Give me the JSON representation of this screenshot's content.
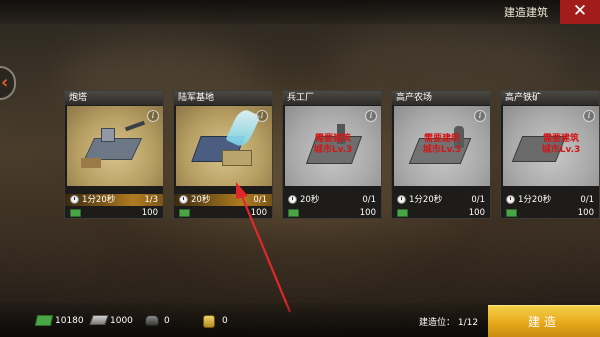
{
  "header": {
    "title": "建造建筑"
  },
  "cards": [
    {
      "name": "炮塔",
      "time": "1分20秒",
      "count": "1/3",
      "cost": "100",
      "available": true,
      "highlight_time": true,
      "requirement": ""
    },
    {
      "name": "陆军基地",
      "time": "20秒",
      "count": "0/1",
      "cost": "100",
      "available": true,
      "highlight_time": true,
      "requirement": ""
    },
    {
      "name": "兵工厂",
      "time": "20秒",
      "count": "0/1",
      "cost": "100",
      "available": false,
      "highlight_time": false,
      "requirement": "需要建筑\n城市Lv.3"
    },
    {
      "name": "高产农场",
      "time": "1分20秒",
      "count": "0/1",
      "cost": "100",
      "available": false,
      "highlight_time": false,
      "requirement": "需要建筑\n城市Lv.3"
    },
    {
      "name": "高产铁矿",
      "time": "1分20秒",
      "count": "0/1",
      "cost": "100",
      "available": false,
      "highlight_time": false,
      "requirement": "需要建筑\n城市Lv.3"
    }
  ],
  "resources": [
    {
      "icon": "cash-icon",
      "value": "10180"
    },
    {
      "icon": "steel-icon",
      "value": "1000"
    },
    {
      "icon": "oil-icon",
      "value": "0"
    },
    {
      "icon": "gold-icon",
      "value": "0"
    }
  ],
  "footer": {
    "slots": "建造位： 1/12",
    "build_label": "建造"
  },
  "colors": {
    "accent": "#e6a91c",
    "close": "#a31c1c",
    "pointer": "#e0282a",
    "requirement": "#d01818"
  }
}
